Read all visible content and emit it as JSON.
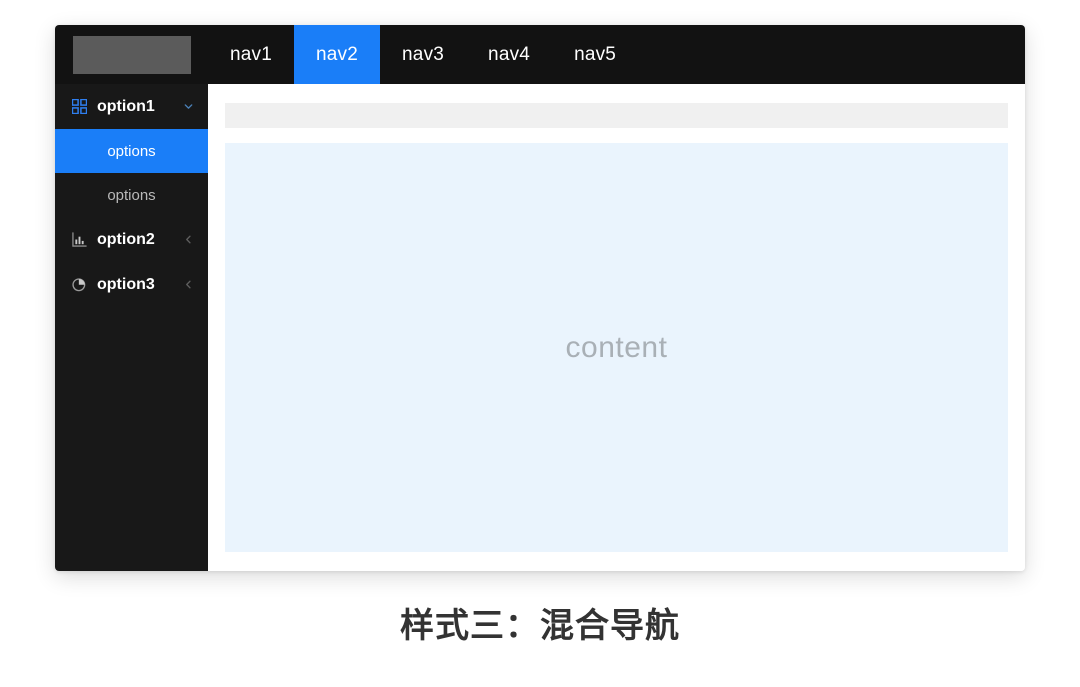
{
  "page": {
    "caption": "样式三：混合导航",
    "background_color": "#ffffff"
  },
  "colors": {
    "accent": "#1a7ef8",
    "nav_bar_bg": "#121212",
    "sidebar_bg": "#181818",
    "logo_placeholder": "#5b5b5b",
    "crumb_bar": "#f0f0f0",
    "content_box": "#eaf4fd",
    "content_text": "#a9b0b6",
    "caption_text": "#333333"
  },
  "window": {
    "logo": {
      "name": "logo-placeholder",
      "label": ""
    },
    "topnav": {
      "items": [
        {
          "label": "nav1",
          "active": false
        },
        {
          "label": "nav2",
          "active": true
        },
        {
          "label": "nav3",
          "active": false
        },
        {
          "label": "nav4",
          "active": false
        },
        {
          "label": "nav5",
          "active": false
        }
      ]
    },
    "sidebar": {
      "groups": [
        {
          "label": "option1",
          "icon": "grid-icon",
          "caret": "chevron-down-icon",
          "expanded": true,
          "children": [
            {
              "label": "options",
              "active": true
            },
            {
              "label": "options",
              "active": false
            }
          ]
        },
        {
          "label": "option2",
          "icon": "bar-chart-icon",
          "caret": "chevron-left-icon",
          "expanded": false,
          "children": []
        },
        {
          "label": "option3",
          "icon": "pie-chart-icon",
          "caret": "chevron-left-icon",
          "expanded": false,
          "children": []
        }
      ]
    },
    "main": {
      "breadcrumb_bar": {
        "label": ""
      },
      "content_placeholder": "content"
    }
  }
}
